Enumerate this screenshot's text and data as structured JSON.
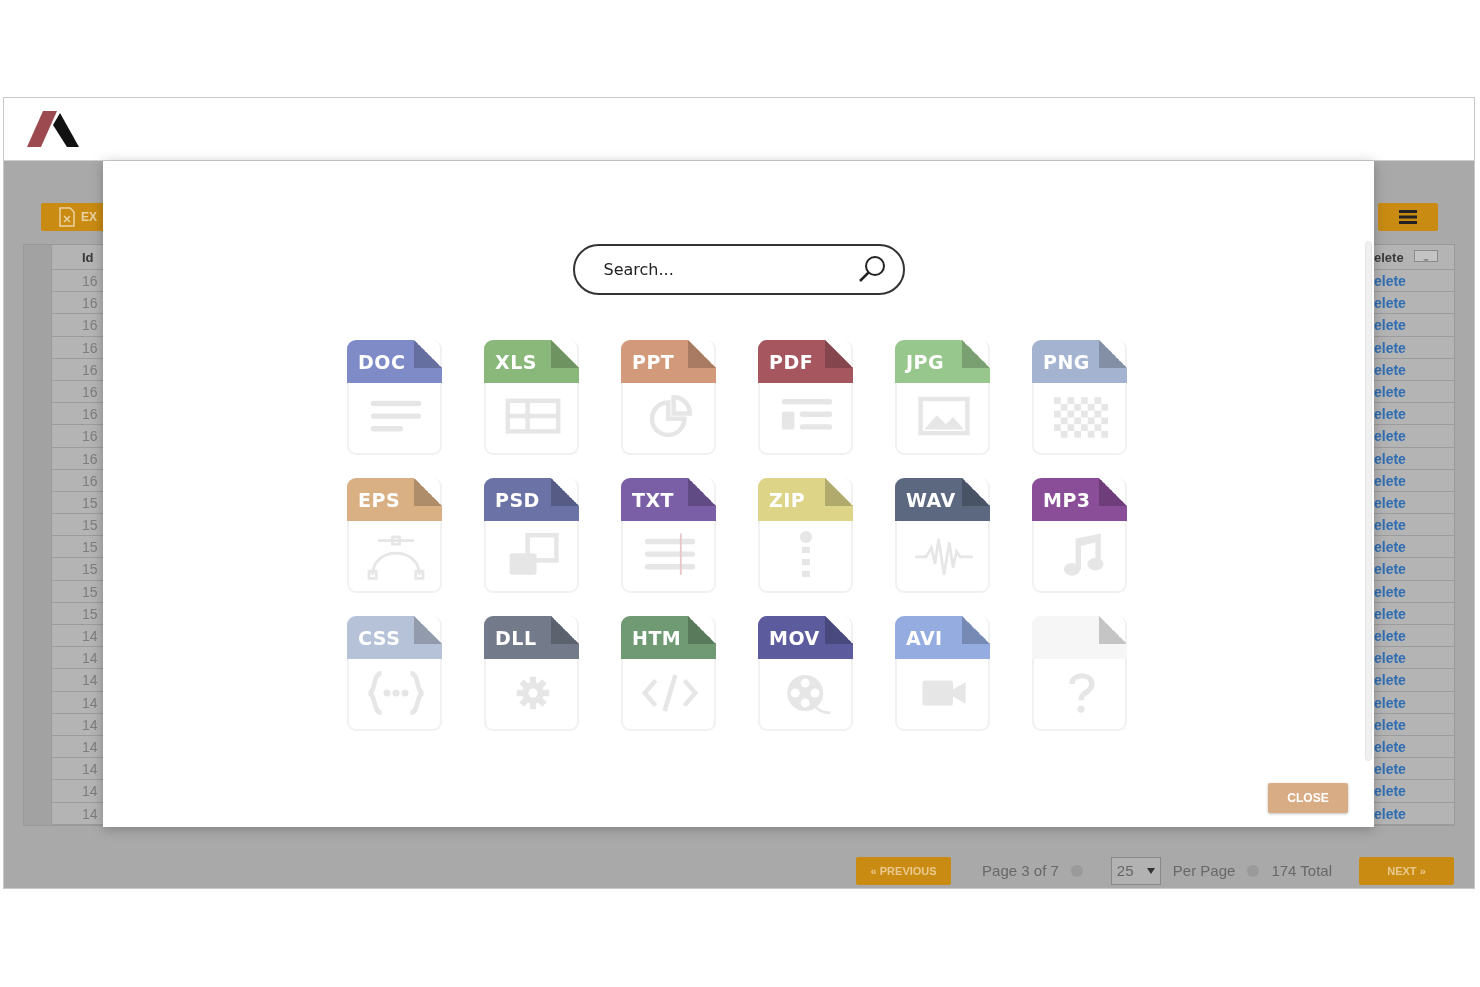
{
  "toolbar": {
    "export_button": "EX"
  },
  "table": {
    "id_header": "Id",
    "action_header": "elete",
    "rows": [
      {
        "id": "16",
        "action": "elete"
      },
      {
        "id": "16",
        "action": "elete"
      },
      {
        "id": "16",
        "action": "elete"
      },
      {
        "id": "16",
        "action": "elete"
      },
      {
        "id": "16",
        "action": "elete"
      },
      {
        "id": "16",
        "action": "elete"
      },
      {
        "id": "16",
        "action": "elete"
      },
      {
        "id": "16",
        "action": "elete"
      },
      {
        "id": "16",
        "action": "elete"
      },
      {
        "id": "16",
        "action": "elete"
      },
      {
        "id": "15",
        "action": "elete"
      },
      {
        "id": "15",
        "action": "elete"
      },
      {
        "id": "15",
        "action": "elete"
      },
      {
        "id": "15",
        "action": "elete"
      },
      {
        "id": "15",
        "action": "elete"
      },
      {
        "id": "15",
        "action": "elete"
      },
      {
        "id": "14",
        "action": "elete"
      },
      {
        "id": "14",
        "action": "elete"
      },
      {
        "id": "14",
        "action": "elete"
      },
      {
        "id": "14",
        "action": "elete"
      },
      {
        "id": "14",
        "action": "elete"
      },
      {
        "id": "14",
        "action": "elete"
      },
      {
        "id": "14",
        "action": "elete"
      },
      {
        "id": "14",
        "action": "elete"
      },
      {
        "id": "14",
        "action": "elete"
      }
    ]
  },
  "pagination": {
    "previous": "« PREVIOUS",
    "page_info": "Page 3 of 7",
    "per_page_value": "25",
    "per_page_label": "Per Page",
    "total": "174 Total",
    "next": "NEXT »"
  },
  "modal": {
    "search": {
      "placeholder": "Search..."
    },
    "file_types": [
      {
        "label": "DOC",
        "color": "#7f8bc7",
        "kind": "doc"
      },
      {
        "label": "XLS",
        "color": "#8ab87a",
        "kind": "sheet"
      },
      {
        "label": "PPT",
        "color": "#d29a7a",
        "kind": "chart"
      },
      {
        "label": "PDF",
        "color": "#a5565f",
        "kind": "layout"
      },
      {
        "label": "JPG",
        "color": "#98c78e",
        "kind": "image"
      },
      {
        "label": "PNG",
        "color": "#a4b3cf",
        "kind": "pattern"
      },
      {
        "label": "EPS",
        "color": "#d9b084",
        "kind": "curve"
      },
      {
        "label": "PSD",
        "color": "#6a72a6",
        "kind": "layers"
      },
      {
        "label": "TXT",
        "color": "#7a5ea6",
        "kind": "text"
      },
      {
        "label": "ZIP",
        "color": "#ddd488",
        "kind": "zipper"
      },
      {
        "label": "WAV",
        "color": "#5b6880",
        "kind": "wave"
      },
      {
        "label": "MP3",
        "color": "#8a4d98",
        "kind": "music"
      },
      {
        "label": "CSS",
        "color": "#b6c2d8",
        "kind": "braces"
      },
      {
        "label": "DLL",
        "color": "#737a8a",
        "kind": "gear"
      },
      {
        "label": "HTM",
        "color": "#6f9a73",
        "kind": "code"
      },
      {
        "label": "MOV",
        "color": "#5c5b9e",
        "kind": "reel"
      },
      {
        "label": "AVI",
        "color": "#94ace0",
        "kind": "camera"
      },
      {
        "color": "#f6f6f6",
        "kind": "question"
      }
    ],
    "close_button": "CLOSE"
  }
}
